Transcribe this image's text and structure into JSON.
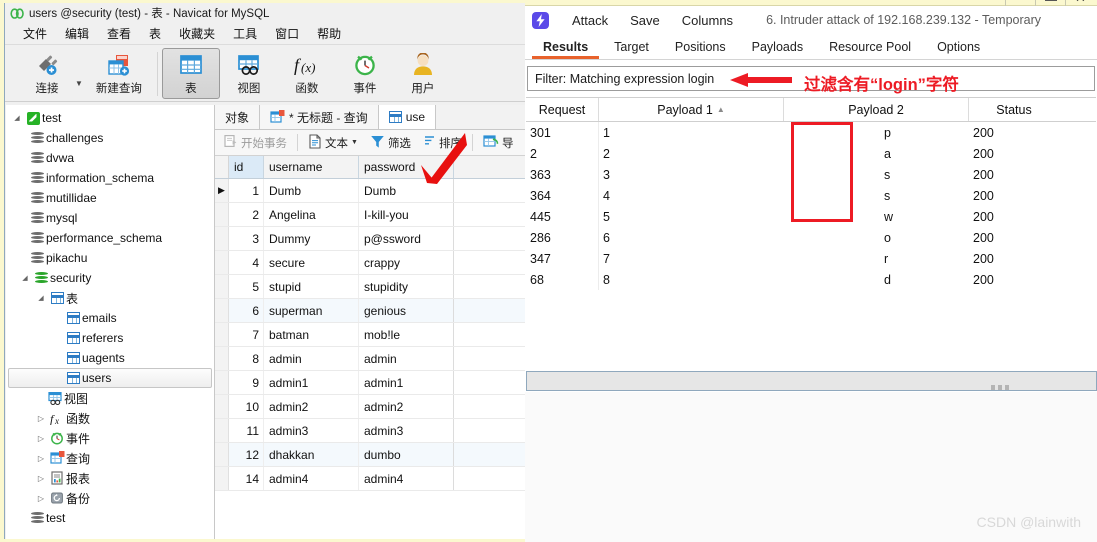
{
  "navicat": {
    "window_title": "users @security (test) - 表 - Navicat for MySQL",
    "title_icon": "navicat-logo-icon",
    "menus": [
      "文件",
      "编辑",
      "查看",
      "表",
      "收藏夹",
      "工具",
      "窗口",
      "帮助"
    ],
    "toolbar": [
      {
        "label": "连接",
        "icon": "connection-plug-add-icon",
        "has_dropdown": true,
        "pressed": false
      },
      {
        "label": "新建查询",
        "icon": "new-query-add-icon",
        "has_dropdown": false,
        "pressed": false
      },
      {
        "label": "表",
        "icon": "table-grid-icon",
        "has_dropdown": false,
        "pressed": true
      },
      {
        "label": "视图",
        "icon": "view-icon",
        "has_dropdown": false,
        "pressed": false
      },
      {
        "label": "函数",
        "icon": "function-fx-icon",
        "has_dropdown": false,
        "pressed": false
      },
      {
        "label": "事件",
        "icon": "event-clock-icon",
        "has_dropdown": false,
        "pressed": false
      },
      {
        "label": "用户",
        "icon": "user-person-icon",
        "has_dropdown": false,
        "pressed": false
      }
    ],
    "tree": [
      {
        "label": "test",
        "icon": "navicat-leaf-icon",
        "depth": 0,
        "arrow": "open",
        "selected": false
      },
      {
        "label": "challenges",
        "icon": "database-icon",
        "depth": 1,
        "arrow": "none",
        "selected": false
      },
      {
        "label": "dvwa",
        "icon": "database-icon",
        "depth": 1,
        "arrow": "none",
        "selected": false
      },
      {
        "label": "information_schema",
        "icon": "database-icon",
        "depth": 1,
        "arrow": "none",
        "selected": false
      },
      {
        "label": "mutillidae",
        "icon": "database-icon",
        "depth": 1,
        "arrow": "none",
        "selected": false
      },
      {
        "label": "mysql",
        "icon": "database-icon",
        "depth": 1,
        "arrow": "none",
        "selected": false
      },
      {
        "label": "performance_schema",
        "icon": "database-icon",
        "depth": 1,
        "arrow": "none",
        "selected": false
      },
      {
        "label": "pikachu",
        "icon": "database-icon",
        "depth": 1,
        "arrow": "none",
        "selected": false
      },
      {
        "label": "security",
        "icon": "database-green-icon",
        "depth": 1,
        "arrow": "open",
        "selected": false
      },
      {
        "label": "表",
        "icon": "table-grid-icon",
        "depth": 2,
        "arrow": "open",
        "selected": false
      },
      {
        "label": "emails",
        "icon": "table-grid-icon",
        "depth": 3,
        "arrow": "none",
        "selected": false
      },
      {
        "label": "referers",
        "icon": "table-grid-icon",
        "depth": 3,
        "arrow": "none",
        "selected": false
      },
      {
        "label": "uagents",
        "icon": "table-grid-icon",
        "depth": 3,
        "arrow": "none",
        "selected": false
      },
      {
        "label": "users",
        "icon": "table-grid-icon",
        "depth": 3,
        "arrow": "none",
        "selected": true
      },
      {
        "label": "视图",
        "icon": "view-icon",
        "depth": 2,
        "arrow": "none",
        "selected": false
      },
      {
        "label": "函数",
        "icon": "function-fx-icon",
        "depth": 2,
        "arrow": "closed",
        "selected": false
      },
      {
        "label": "事件",
        "icon": "event-clock-icon",
        "depth": 2,
        "arrow": "closed",
        "selected": false
      },
      {
        "label": "查询",
        "icon": "query-icon",
        "depth": 2,
        "arrow": "closed",
        "selected": false
      },
      {
        "label": "报表",
        "icon": "report-icon",
        "depth": 2,
        "arrow": "closed",
        "selected": false
      },
      {
        "label": "备份",
        "icon": "backup-icon",
        "depth": 2,
        "arrow": "closed",
        "selected": false
      },
      {
        "label": "test",
        "icon": "database-icon",
        "depth": 1,
        "arrow": "none",
        "selected": false
      }
    ],
    "tabs": [
      {
        "label": "对象",
        "icon": "none",
        "active": false
      },
      {
        "label": "* 无标题 - 查询",
        "icon": "query-icon",
        "active": false
      },
      {
        "label": "use",
        "icon": "table-grid-icon",
        "active": true
      }
    ],
    "subtoolbar": [
      {
        "label": "开始事务",
        "icon": "transaction-icon",
        "disabled": true,
        "dropdown": false
      },
      {
        "label": "文本",
        "icon": "text-doc-icon",
        "disabled": false,
        "dropdown": true
      },
      {
        "label": "筛选",
        "icon": "filter-funnel-icon",
        "disabled": false,
        "dropdown": false
      },
      {
        "label": "排序",
        "icon": "sort-icon",
        "disabled": false,
        "dropdown": false
      },
      {
        "label": "导",
        "icon": "export-icon",
        "disabled": false,
        "dropdown": false
      }
    ],
    "grid": {
      "columns": [
        "id",
        "username",
        "password"
      ],
      "rows": [
        {
          "id": "1",
          "username": "Dumb",
          "password": "Dumb",
          "current": true
        },
        {
          "id": "2",
          "username": "Angelina",
          "password": "I-kill-you",
          "current": false
        },
        {
          "id": "3",
          "username": "Dummy",
          "password": "p@ssword",
          "current": false
        },
        {
          "id": "4",
          "username": "secure",
          "password": "crappy",
          "current": false
        },
        {
          "id": "5",
          "username": "stupid",
          "password": "stupidity",
          "current": false
        },
        {
          "id": "6",
          "username": "superman",
          "password": "genious",
          "current": false
        },
        {
          "id": "7",
          "username": "batman",
          "password": "mob!le",
          "current": false
        },
        {
          "id": "8",
          "username": "admin",
          "password": "admin",
          "current": false
        },
        {
          "id": "9",
          "username": "admin1",
          "password": "admin1",
          "current": false
        },
        {
          "id": "10",
          "username": "admin2",
          "password": "admin2",
          "current": false
        },
        {
          "id": "11",
          "username": "admin3",
          "password": "admin3",
          "current": false
        },
        {
          "id": "12",
          "username": "dhakkan",
          "password": "dumbo",
          "current": false
        },
        {
          "id": "14",
          "username": "admin4",
          "password": "admin4",
          "current": false
        }
      ]
    },
    "annotation": {
      "arrow": "red-arrow-pointing-to-filter-button"
    }
  },
  "burp": {
    "logo_icon": "burp-suite-lightning-icon",
    "menus": [
      "Attack",
      "Save",
      "Columns"
    ],
    "attack_title": "6. Intruder attack of 192.168.239.132 - Temporary",
    "window_controls": [
      "minimize-icon",
      "maximize-icon",
      "close-icon"
    ],
    "tabs": [
      {
        "label": "Results",
        "active": true
      },
      {
        "label": "Target",
        "active": false
      },
      {
        "label": "Positions",
        "active": false
      },
      {
        "label": "Payloads",
        "active": false
      },
      {
        "label": "Resource Pool",
        "active": false
      },
      {
        "label": "Options",
        "active": false
      }
    ],
    "filter": {
      "text": "Filter: Matching expression login"
    },
    "annotation": {
      "arrow_icon": "left-pointing-red-arrow",
      "text": "过滤含有“login”字符",
      "color": "#ed1b24",
      "highlight_box": "red-box-around-payload2-column"
    },
    "results": {
      "columns": [
        {
          "label": "Request",
          "sort": "none"
        },
        {
          "label": "Payload 1",
          "sort": "asc"
        },
        {
          "label": "Payload 2",
          "sort": "none"
        },
        {
          "label": "Status",
          "sort": "none"
        }
      ],
      "rows": [
        {
          "request": "301",
          "payload1": "1",
          "payload2": "p",
          "status": "200"
        },
        {
          "request": "2",
          "payload1": "2",
          "payload2": "a",
          "status": "200"
        },
        {
          "request": "363",
          "payload1": "3",
          "payload2": "s",
          "status": "200"
        },
        {
          "request": "364",
          "payload1": "4",
          "payload2": "s",
          "status": "200"
        },
        {
          "request": "445",
          "payload1": "5",
          "payload2": "w",
          "status": "200"
        },
        {
          "request": "286",
          "payload1": "6",
          "payload2": "o",
          "status": "200"
        },
        {
          "request": "347",
          "payload1": "7",
          "payload2": "r",
          "status": "200"
        },
        {
          "request": "68",
          "payload1": "8",
          "payload2": "d",
          "status": "200"
        }
      ]
    }
  },
  "watermark": {
    "text": "CSDN @lainwith"
  },
  "colors": {
    "burp_accent": "#e8622c",
    "burp_logo": "#5b4ae8",
    "annotation_red": "#ed1b24",
    "navicat_window_border": "#fbf8cf",
    "selected_column_header": "#dbeaf7"
  }
}
